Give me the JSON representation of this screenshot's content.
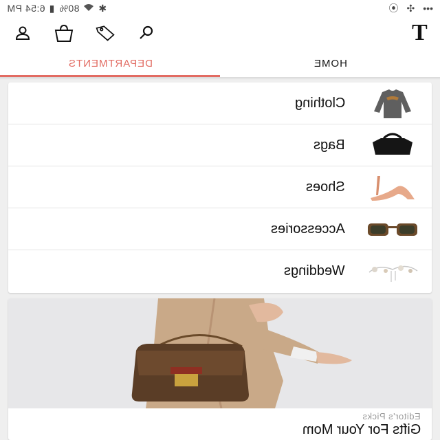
{
  "status_bar": {
    "time": "6:54 PM",
    "battery": "80%",
    "overflow": "•••"
  },
  "header": {
    "brand": "T",
    "icons": [
      "account-icon",
      "shopping-bag-icon",
      "tag-icon",
      "search-icon"
    ]
  },
  "tabs": [
    {
      "label": "HOME",
      "active": false
    },
    {
      "label": "DEPARTMENTS",
      "active": true
    }
  ],
  "departments": [
    {
      "label": "Clothing",
      "icon": "sweater-thumbnail"
    },
    {
      "label": "Bags",
      "icon": "handbag-thumbnail"
    },
    {
      "label": "Shoes",
      "icon": "heel-thumbnail"
    },
    {
      "label": "Accessories",
      "icon": "sunglasses-thumbnail"
    },
    {
      "label": "Weddings",
      "icon": "wedding-thumbnail"
    }
  ],
  "feature": {
    "eyebrow": "Editor's Picks",
    "title": "Gifts For Your Mom"
  },
  "colors": {
    "accent": "#e26b62",
    "background": "#efefef"
  }
}
